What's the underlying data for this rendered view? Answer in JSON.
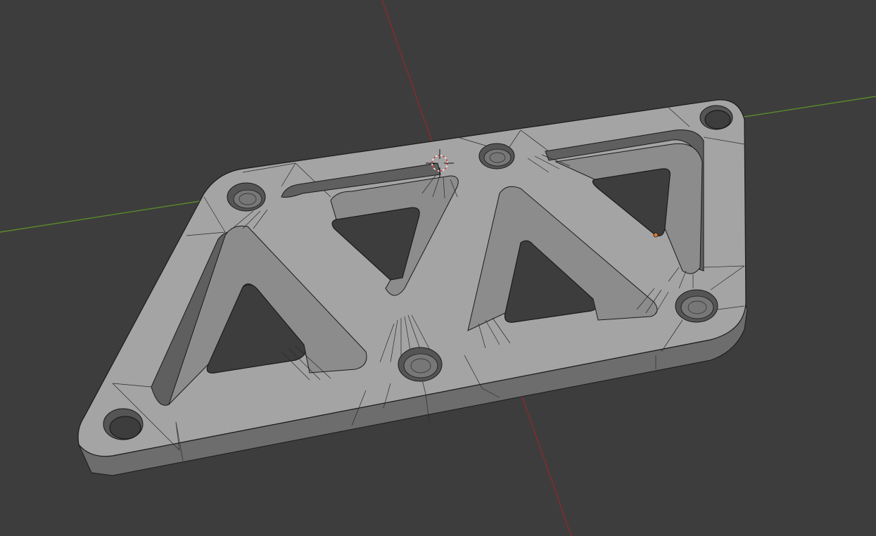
{
  "viewport": {
    "background_color": "#3d3d3d",
    "x_axis_color": "#8a2a2a",
    "y_axis_color": "#5a8a2a",
    "mesh_face_color": "#a4a4a4",
    "mesh_side_color": "#6d6d6d",
    "wire_color": "#1e1e1e",
    "cursor_color": "#d04040",
    "origin_color": "#e07a30"
  },
  "objects": {
    "mesh": "bracket-plate",
    "cursor": "3d-cursor-icon",
    "origin": "object-origin-dot"
  }
}
